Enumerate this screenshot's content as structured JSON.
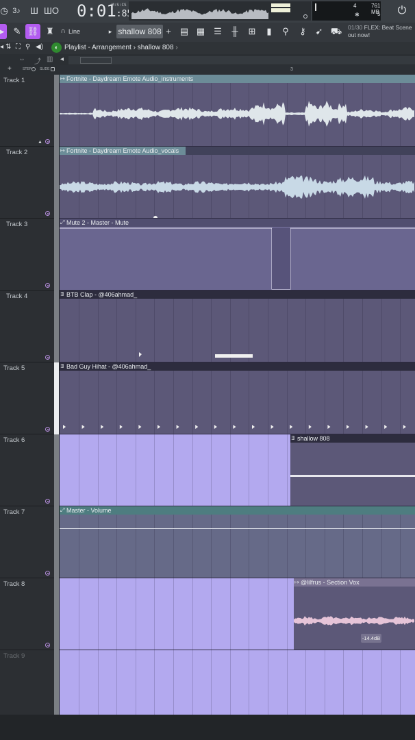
{
  "toolbar": {
    "time": {
      "main": "0:01",
      "fraction": ":85",
      "label": "M:S:CS"
    },
    "cpu": {
      "value": "4",
      "memory": "761 MB",
      "polyphony": "5"
    },
    "mode": "Line",
    "pattern": "shallow 808",
    "news": {
      "counter": "01/30",
      "text": "FLEX: Beat Scene out now!"
    },
    "left_icons": [
      "clock-icon",
      "tempo-icon",
      "step-icon",
      "wave-icon"
    ]
  },
  "playlist": {
    "crumb_root": "Playlist - Arrangement",
    "crumb_sep": "›",
    "crumb_pattern": "shallow 808",
    "toggles": {
      "step": "STEP",
      "slide": "SLIDE"
    },
    "ruler_mark": "3"
  },
  "tracks": [
    {
      "name": "Track 1",
      "clip": "Fortnite - Daydream Emote Audio_instruments",
      "type": "audio"
    },
    {
      "name": "Track 2",
      "clip": "Fortnite - Daydream Emote Audio_vocals",
      "type": "audio"
    },
    {
      "name": "Track 3",
      "clip": "Mute 2 - Master - Mute",
      "type": "automation"
    },
    {
      "name": "Track 4",
      "clip": "BTB Clap - @406ahmad_",
      "type": "pattern"
    },
    {
      "name": "Track 5",
      "clip": "Bad Guy Hihat - @406ahmad_",
      "type": "pattern"
    },
    {
      "name": "Track 6",
      "clip": "shallow 808",
      "type": "pattern"
    },
    {
      "name": "Track 7",
      "clip": "Master - Volume",
      "type": "automation"
    },
    {
      "name": "Track 8",
      "clip": "@lilfrus - Section Vox",
      "type": "audio",
      "gain": "-14.4dB"
    },
    {
      "name": "Track 9",
      "clip": "",
      "type": "empty"
    }
  ],
  "colors": {
    "accent": "#b35cf0",
    "lane": "#5c5878",
    "lane_selected": "#b3a9ef",
    "clip_header_audio": "#6f8f9a",
    "clip_header_pattern": "#3b3a52"
  }
}
